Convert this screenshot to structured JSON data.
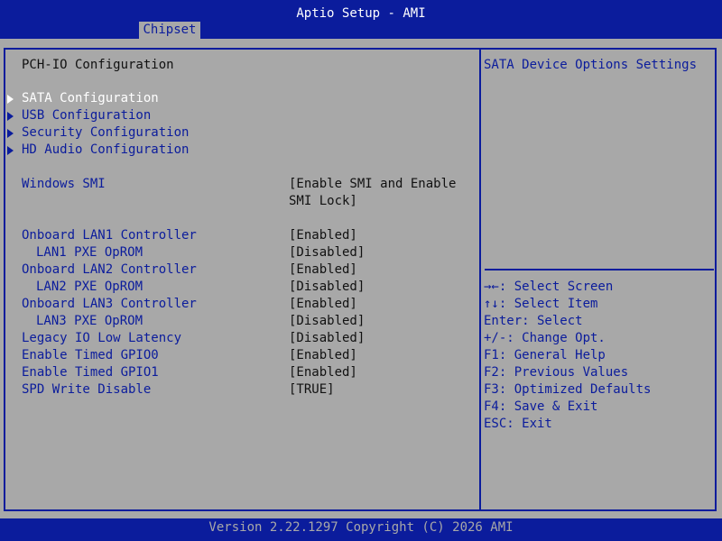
{
  "window": {
    "title": "Aptio Setup - AMI",
    "active_tab": "Chipset"
  },
  "page_title": "PCH-IO Configuration",
  "submenus": [
    {
      "label": "SATA Configuration",
      "selected": true
    },
    {
      "label": "USB Configuration"
    },
    {
      "label": "Security Configuration"
    },
    {
      "label": "HD Audio Configuration"
    }
  ],
  "windows_smi": {
    "label": "Windows SMI",
    "value_line1": "[Enable SMI and Enable",
    "value_line2": "SMI Lock]"
  },
  "settings": [
    {
      "label": "Onboard LAN1 Controller",
      "value": "[Enabled]"
    },
    {
      "label": "LAN1 PXE OpROM",
      "value": "[Disabled]"
    },
    {
      "label": "Onboard LAN2 Controller",
      "value": "[Enabled]"
    },
    {
      "label": "LAN2 PXE OpROM",
      "value": "[Disabled]"
    },
    {
      "label": "Onboard LAN3 Controller",
      "value": "[Enabled]"
    },
    {
      "label": "LAN3 PXE OpROM",
      "value": "[Disabled]"
    },
    {
      "label": "Legacy IO Low Latency",
      "value": "[Disabled]"
    },
    {
      "label": "Enable Timed GPIO0",
      "value": "[Enabled]"
    },
    {
      "label": "Enable Timed GPIO1",
      "value": "[Enabled]"
    },
    {
      "label": "SPD Write Disable",
      "value": "[TRUE]"
    }
  ],
  "help": {
    "text": "SATA Device Options Settings"
  },
  "keys": [
    "→←: Select Screen",
    "↑↓: Select Item",
    "Enter: Select",
    "+/-: Change Opt.",
    "F1: General Help",
    "F2: Previous Values",
    "F3: Optimized Defaults",
    "F4: Save & Exit",
    "ESC: Exit"
  ],
  "footer": "Version 2.22.1297 Copyright (C) 2026 AMI"
}
